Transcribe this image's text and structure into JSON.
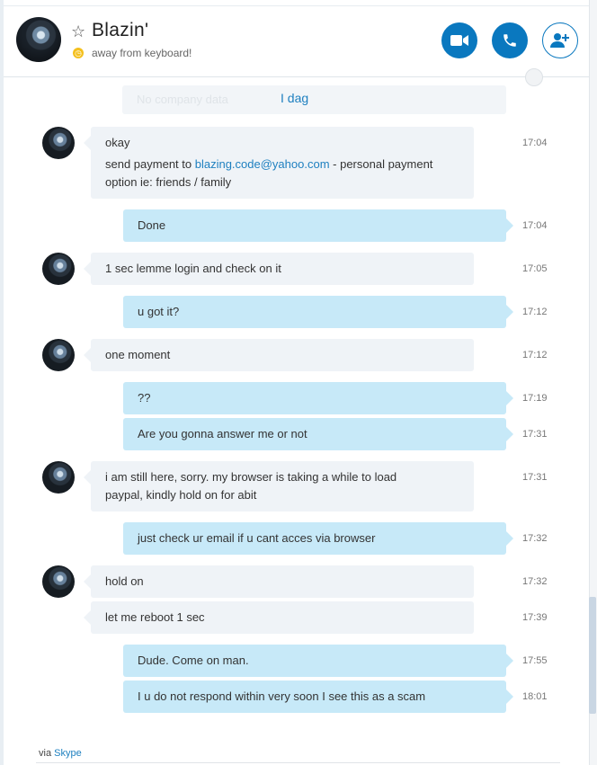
{
  "header": {
    "contact_name": "Blazin'",
    "status_text": "away from keyboard!",
    "status_color": "#f4c01e",
    "accent_color": "#0a78bf",
    "icons": {
      "favorite": "star-outline-icon",
      "status": "clock-icon",
      "video": "video-camera-icon",
      "call": "phone-icon",
      "add_people": "add-person-icon",
      "globe": "globe-icon"
    }
  },
  "company_bar": {
    "faded_text": "No company data",
    "link_text": "I dag"
  },
  "messages": [
    {
      "sender": "contact",
      "avatar": true,
      "lines": [
        "okay"
      ],
      "time": "17:04"
    },
    {
      "sender": "contact",
      "avatar": false,
      "lines": [
        "send payment to ",
        "blazing.code@yahoo.com",
        " - personal payment",
        "option ie: friends / family"
      ],
      "time": ""
    },
    {
      "sender": "me",
      "lines": [
        "Done"
      ],
      "time": "17:04"
    },
    {
      "sender": "contact",
      "avatar": true,
      "lines": [
        "1 sec lemme login and check on it"
      ],
      "time": "17:05"
    },
    {
      "sender": "me",
      "lines": [
        "u got it?"
      ],
      "time": "17:12"
    },
    {
      "sender": "contact",
      "avatar": true,
      "lines": [
        "one moment"
      ],
      "time": "17:12"
    },
    {
      "sender": "me",
      "lines": [
        "??"
      ],
      "time": "17:19"
    },
    {
      "sender": "me",
      "lines": [
        "Are you gonna answer me or not"
      ],
      "time": "17:31"
    },
    {
      "sender": "contact",
      "avatar": true,
      "lines": [
        "i am still here, sorry. my browser is taking a while to load",
        "paypal, kindly hold on for  abit"
      ],
      "time": "17:31"
    },
    {
      "sender": "me",
      "lines": [
        "just check ur email if u cant acces via browser"
      ],
      "time": "17:32"
    },
    {
      "sender": "contact",
      "avatar": true,
      "lines": [
        "hold on"
      ],
      "time": "17:32"
    },
    {
      "sender": "contact",
      "avatar": false,
      "lines": [
        "let me reboot 1 sec"
      ],
      "time": "17:39"
    },
    {
      "sender": "me",
      "lines": [
        "Dude. Come on man."
      ],
      "time": "17:55"
    },
    {
      "sender": "me",
      "lines": [
        "I u do not respond within very soon I see this as a scam"
      ],
      "time": "18:01"
    }
  ],
  "footer": {
    "via_text": "via",
    "service_link": "Skype"
  }
}
